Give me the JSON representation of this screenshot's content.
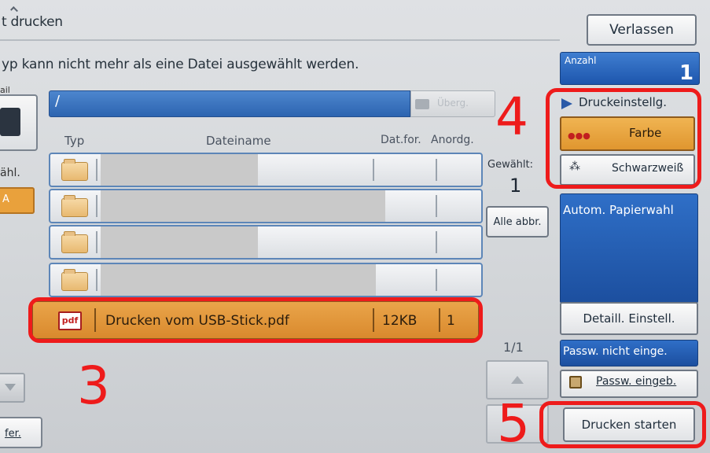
{
  "header": {
    "title": "t drucken",
    "exit_label": "Verlassen",
    "notice": "yp kann nicht mehr als eine Datei ausgewählt werden."
  },
  "left_stub": {
    "label_top": "ail",
    "label_mid": "ähl.",
    "orange_label": "A",
    "bottom_button": "fer."
  },
  "browser": {
    "path": "/",
    "folder_up_label": "Überg.",
    "columns": {
      "type": "Typ",
      "name": "Dateiname",
      "format": "Dat.for.",
      "order": "Anordg."
    },
    "rows": [
      {
        "type": "folder"
      },
      {
        "type": "folder"
      },
      {
        "type": "folder"
      },
      {
        "type": "folder"
      },
      {
        "type": "pdf",
        "icon_label": "pdf",
        "name": "Drucken vom USB-Stick.pdf",
        "size": "12KB",
        "order": "1",
        "selected": true
      }
    ]
  },
  "selection": {
    "label": "Gewählt:",
    "count": "1",
    "deselect_label": "Alle abbr.",
    "page": "1/1"
  },
  "quantity": {
    "label": "Anzahl",
    "value": "1"
  },
  "print_settings": {
    "header": "Druckeinstellg.",
    "color_label": "Farbe",
    "bw_label": "Schwarzweiß",
    "paper_label": "Autom. Papierwahl",
    "detail_label": "Detaill. Einstell.",
    "password_status": "Passw. nicht einge.",
    "password_button": "Passw. eingeb.",
    "start_label": "Drucken starten"
  },
  "annotations": {
    "step3": "3",
    "step4": "4",
    "step5": "5",
    "color": "#ee1b1b"
  },
  "colors": {
    "accent_blue": "#2d64b0",
    "selected_orange": "#e0962f"
  }
}
